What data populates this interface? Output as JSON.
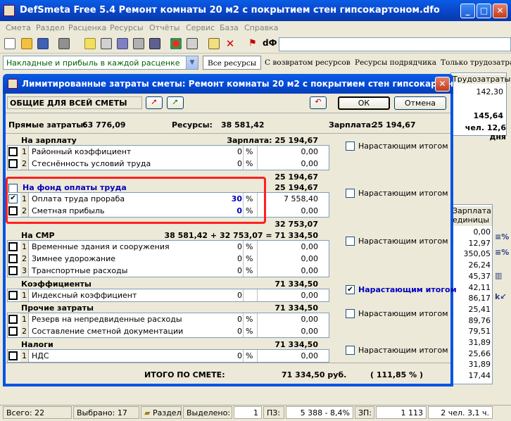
{
  "window": {
    "title": "DefSmeta Free 5.4   Ремонт комнаты 20 м2 с покрытием стен гипсокартоном.dfo"
  },
  "menu": [
    "Смета",
    "Раздел",
    "Расценка",
    "Ресурсы",
    "Отчёты",
    "Сервис",
    "База",
    "Справка"
  ],
  "toolbar2": {
    "combo_value": "Накладные и прибыль в каждой расценке",
    "tabs": [
      "Все ресурсы",
      "С возвратом ресурсов",
      "Ресурсы подрядчика",
      "Только трудозатраты"
    ]
  },
  "background": {
    "col_header1": "Трудозатраты",
    "row_values1": [
      "142,30",
      "",
      "145,64",
      "чел. 12,6 дня"
    ],
    "col_header2": [
      "Зарплата",
      "единицы"
    ],
    "values2": [
      "0,00",
      "12,97",
      "350,05",
      "26,24",
      "45,37",
      "42,11",
      "86,17",
      "25,41",
      "89,76",
      "79,51",
      "31,89",
      "25,66",
      "31,89",
      "17,44"
    ]
  },
  "dialog": {
    "title": "Лимитированные затраты сметы: Ремонт комнаты 20 м2 с покрытием стен гипсокартоно...",
    "scope_label": "ОБЩИЕ ДЛЯ ВСЕЙ СМЕТЫ",
    "ok_label": "ОК",
    "cancel_label": "Отмена",
    "summary": {
      "direct_label": "Прямые затраты:",
      "direct_value": "63 776,09",
      "resources_label": "Ресурсы:",
      "resources_value": "38 581,42",
      "salary_label": "Зарплата:",
      "salary_value": "25 194,67"
    },
    "sections": [
      {
        "title": "На зарплату",
        "header_right": "Зарплата:   25 194,67",
        "after": "25 194,67",
        "cumulative": "Нарастающим итогом",
        "rows": [
          {
            "n": "1",
            "name": "Районный коэффициент",
            "pct": "0",
            "unit": "%",
            "sum": "0,00"
          },
          {
            "n": "2",
            "name": "Стеснённость условий труда",
            "pct": "0",
            "unit": "%",
            "sum": "0,00"
          }
        ]
      },
      {
        "title": "На фонд оплаты труда",
        "header_right": "25 194,67",
        "after": "32 753,07",
        "cumulative": "Нарастающим итогом",
        "rows": [
          {
            "n": "1",
            "name": "Оплата труда прораба",
            "pct": "30",
            "unit": "%",
            "sum": "7 558,40"
          },
          {
            "n": "2",
            "name": "Сметная прибыль",
            "pct": "0",
            "unit": "%",
            "sum": "0,00"
          }
        ]
      },
      {
        "title": "На СМР",
        "header_right": "38 581,42  +  32 753,07  =  71 334,50",
        "cumulative": "Нарастающим итогом",
        "rows": [
          {
            "n": "1",
            "name": "Временные здания и сооружения",
            "pct": "0",
            "unit": "%",
            "sum": "0,00"
          },
          {
            "n": "2",
            "name": "Зимнее удорожание",
            "pct": "0",
            "unit": "%",
            "sum": "0,00"
          },
          {
            "n": "3",
            "name": "Транспортные расходы",
            "pct": "0",
            "unit": "%",
            "sum": "0,00"
          }
        ]
      },
      {
        "title": "Коэффициенты",
        "header_right": "71 334,50",
        "cumulative": "Нарастающим итогом",
        "rows": [
          {
            "n": "1",
            "name": "Индексный коэффициент",
            "pct": "0",
            "unit": "",
            "sum": "0,00"
          }
        ]
      },
      {
        "title": "Прочие затраты",
        "header_right": "71 334,50",
        "cumulative": "Нарастающим итогом",
        "rows": [
          {
            "n": "1",
            "name": "Резерв на непредвиденные расходы",
            "pct": "0",
            "unit": "%",
            "sum": "0,00"
          },
          {
            "n": "2",
            "name": "Составление сметной документации",
            "pct": "0",
            "unit": "%",
            "sum": "0,00"
          }
        ]
      },
      {
        "title": "Налоги",
        "header_right": "71 334,50",
        "cumulative": "Нарастающим итогом",
        "rows": [
          {
            "n": "1",
            "name": "НДС",
            "pct": "0",
            "unit": "%",
            "sum": "0,00"
          }
        ]
      }
    ],
    "total": {
      "label": "ИТОГО ПО СМЕТЕ:",
      "value": "71 334,50  руб.",
      "percent": "( 111,85 % )"
    }
  },
  "status": {
    "total": "Всего: 22",
    "selected": "Выбрано: 17",
    "section": "Раздел",
    "highlighted_label": "Выделено:",
    "highlighted_value": "1",
    "pz_label": "ПЗ:",
    "pz_value": "5 388 - 8,4%",
    "zp_label": "ЗП:",
    "zp_value": "1 113",
    "workers": "2 чел. 3,1 ч."
  },
  "colors": {
    "accent": "#0054e3",
    "highlight": "#ff2020",
    "blue_text": "#0000c0"
  }
}
